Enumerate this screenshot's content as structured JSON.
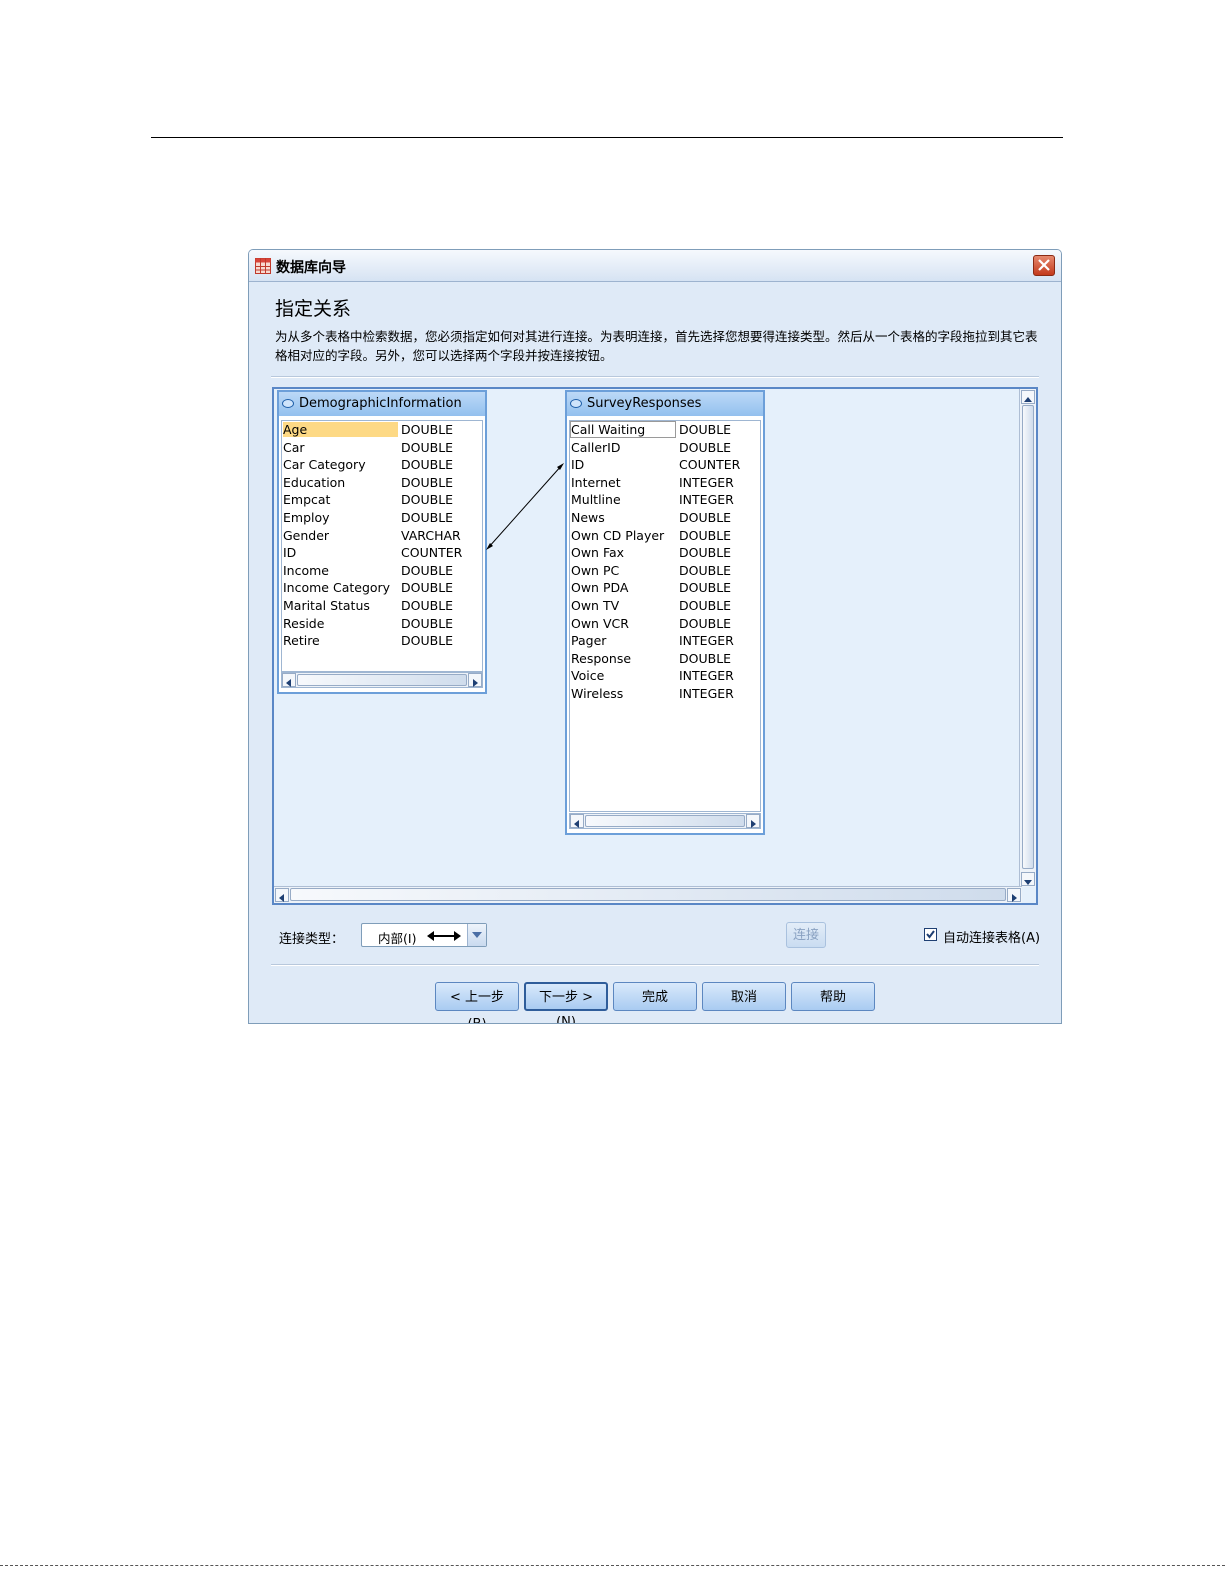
{
  "window": {
    "title": "数据库向导"
  },
  "page": {
    "heading": "指定关系",
    "description": "为从多个表格中检索数据，您必须指定如何对其进行连接。为表明连接，首先选择您想要得连接类型。然后从一个表格的字段拖拉到其它表格相对应的字段。另外，您可以选择两个字段并按连接按钮。"
  },
  "tables": {
    "left": {
      "name": "DemographicInformation",
      "fields": [
        {
          "name": "Age",
          "type": "DOUBLE"
        },
        {
          "name": "Car",
          "type": "DOUBLE"
        },
        {
          "name": "Car Category",
          "type": "DOUBLE"
        },
        {
          "name": "Education",
          "type": "DOUBLE"
        },
        {
          "name": "Empcat",
          "type": "DOUBLE"
        },
        {
          "name": "Employ",
          "type": "DOUBLE"
        },
        {
          "name": "Gender",
          "type": "VARCHAR"
        },
        {
          "name": "ID",
          "type": "COUNTER"
        },
        {
          "name": "Income",
          "type": "DOUBLE"
        },
        {
          "name": "Income Category",
          "type": "DOUBLE"
        },
        {
          "name": "Marital Status",
          "type": "DOUBLE"
        },
        {
          "name": "Reside",
          "type": "DOUBLE"
        },
        {
          "name": "Retire",
          "type": "DOUBLE"
        }
      ]
    },
    "right": {
      "name": "SurveyResponses",
      "fields": [
        {
          "name": "Call Waiting",
          "type": "DOUBLE"
        },
        {
          "name": "CallerID",
          "type": "DOUBLE"
        },
        {
          "name": "ID",
          "type": "COUNTER"
        },
        {
          "name": "Internet",
          "type": "INTEGER"
        },
        {
          "name": "Multline",
          "type": "INTEGER"
        },
        {
          "name": "News",
          "type": "DOUBLE"
        },
        {
          "name": "Own CD Player",
          "type": "DOUBLE"
        },
        {
          "name": "Own Fax",
          "type": "DOUBLE"
        },
        {
          "name": "Own PC",
          "type": "DOUBLE"
        },
        {
          "name": "Own PDA",
          "type": "DOUBLE"
        },
        {
          "name": "Own TV",
          "type": "DOUBLE"
        },
        {
          "name": "Own VCR",
          "type": "DOUBLE"
        },
        {
          "name": "Pager",
          "type": "INTEGER"
        },
        {
          "name": "Response",
          "type": "DOUBLE"
        },
        {
          "name": "Voice",
          "type": "INTEGER"
        },
        {
          "name": "Wireless",
          "type": "INTEGER"
        }
      ]
    }
  },
  "join_options": {
    "join_type_label": "连接类型：",
    "join_type_value": "内部(I)",
    "connect_button": "连接",
    "auto_join_label": "自动连接表格(A)",
    "auto_join_checked": true
  },
  "buttons": {
    "back": "< 上一步(B)",
    "next": "下一步 >(N)",
    "finish": "完成",
    "cancel": "取消",
    "help": "帮助"
  },
  "colors": {
    "selection": "#fdd985",
    "table_header": "#93c0ee",
    "canvas_bg": "#e5f0fb"
  }
}
